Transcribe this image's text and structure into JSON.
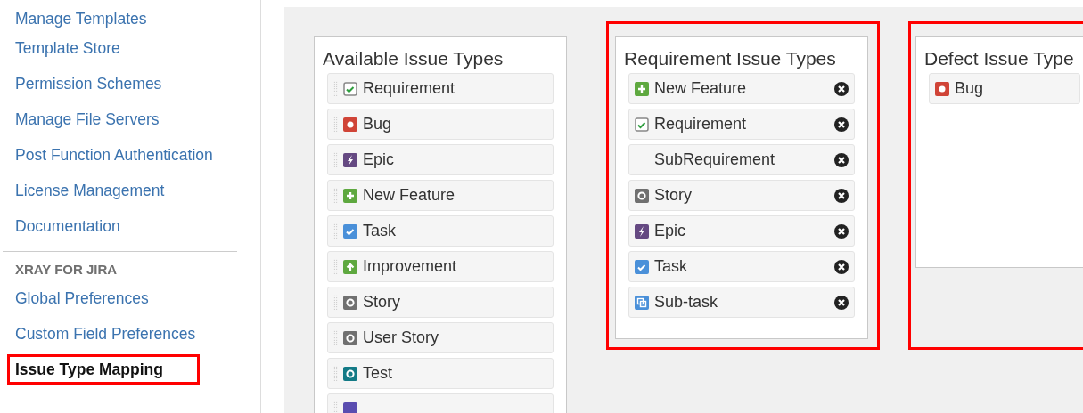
{
  "sidebar": {
    "items": [
      {
        "kind": "link",
        "label": "Manage Templates",
        "selected": false,
        "highlighted": false
      },
      {
        "kind": "link",
        "label": "Template Store",
        "selected": false,
        "highlighted": false
      },
      {
        "kind": "link",
        "label": "Permission Schemes",
        "selected": false,
        "highlighted": false
      },
      {
        "kind": "link",
        "label": "Manage File Servers",
        "selected": false,
        "highlighted": false
      },
      {
        "kind": "link",
        "label": "Post Function Authentication",
        "selected": false,
        "highlighted": false
      },
      {
        "kind": "link",
        "label": "License Management",
        "selected": false,
        "highlighted": false
      },
      {
        "kind": "link",
        "label": "Documentation",
        "selected": false,
        "highlighted": false
      },
      {
        "kind": "divider"
      },
      {
        "kind": "heading",
        "label": "XRAY FOR JIRA"
      },
      {
        "kind": "link",
        "label": "Global Preferences",
        "selected": false,
        "highlighted": false
      },
      {
        "kind": "link",
        "label": "Custom Field Preferences",
        "selected": false,
        "highlighted": false
      },
      {
        "kind": "link",
        "label": "Issue Type Mapping",
        "selected": true,
        "highlighted": true
      }
    ]
  },
  "panels": [
    {
      "title": "Available Issue Types",
      "highlighted": false,
      "draggable": true,
      "removable": false,
      "items": [
        {
          "kind": "requirement",
          "label": "Requirement"
        },
        {
          "kind": "bug",
          "label": "Bug"
        },
        {
          "kind": "epic",
          "label": "Epic"
        },
        {
          "kind": "feature",
          "label": "New Feature"
        },
        {
          "kind": "task",
          "label": "Task"
        },
        {
          "kind": "improvement",
          "label": "Improvement"
        },
        {
          "kind": "story",
          "label": "Story"
        },
        {
          "kind": "story",
          "label": "User Story"
        },
        {
          "kind": "test",
          "label": "Test"
        },
        {
          "kind": "testset"
        }
      ]
    },
    {
      "title": "Requirement Issue Types",
      "highlighted": true,
      "draggable": false,
      "removable": true,
      "items": [
        {
          "kind": "feature",
          "label": "New Feature"
        },
        {
          "kind": "requirement",
          "label": "Requirement"
        },
        {
          "kind": "plain",
          "label": "SubRequirement"
        },
        {
          "kind": "story",
          "label": "Story"
        },
        {
          "kind": "epic",
          "label": "Epic"
        },
        {
          "kind": "task",
          "label": "Task"
        },
        {
          "kind": "subtask",
          "label": "Sub-task"
        }
      ]
    },
    {
      "title": "Defect Issue Type",
      "highlighted": true,
      "draggable": false,
      "removable": false,
      "items": [
        {
          "kind": "bug",
          "label": "Bug"
        }
      ]
    }
  ]
}
